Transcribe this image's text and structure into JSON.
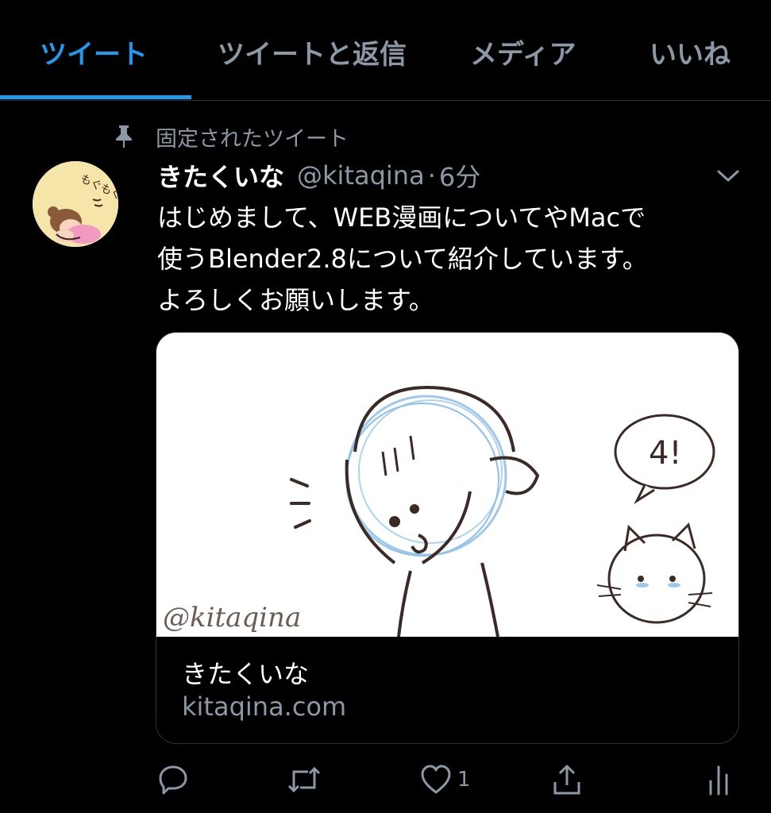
{
  "tabs": [
    {
      "label": "ツイート",
      "active": true
    },
    {
      "label": "ツイートと返信",
      "active": false
    },
    {
      "label": "メディア",
      "active": false
    },
    {
      "label": "いいね",
      "active": false
    }
  ],
  "pinned": {
    "label": "固定されたツイート"
  },
  "tweet": {
    "name": "きたくいな",
    "handle": "@kitaqina",
    "separator": "·",
    "time": "6分",
    "text_lines": [
      "はじめまして、WEB漫画についてやMacで",
      "使うBlender2.8について紹介しています。",
      "よろしくお願いします。"
    ],
    "avatar_text": "もぐもぐ"
  },
  "card": {
    "title": "きたくいな",
    "domain": "kitaqina.com",
    "image_watermark": "@kitaqina",
    "image_bubble_text": "4!"
  },
  "actions": {
    "like_count": "1"
  },
  "colors": {
    "accent": "#1d9bf0",
    "muted": "#8b98a5",
    "background": "#000000",
    "border": "#2f3336"
  }
}
